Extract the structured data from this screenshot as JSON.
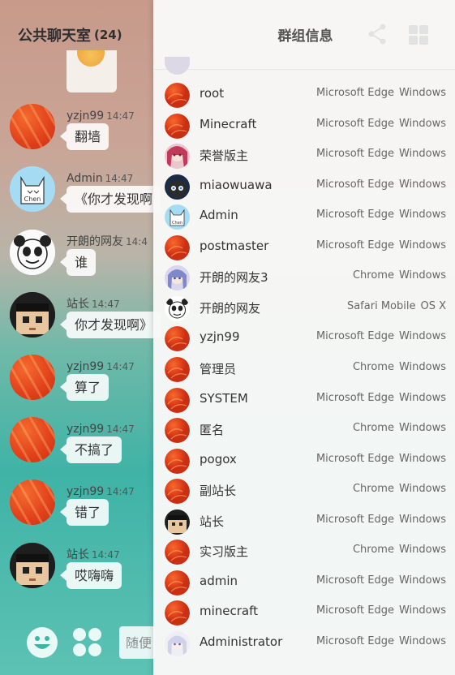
{
  "chat": {
    "title": "公共聊天室",
    "count": "(24)",
    "input_placeholder": "随便"
  },
  "messages": [
    {
      "nick": "yzjn99",
      "time": "14:47",
      "text": "翻墙",
      "avatar": "orange-avatar"
    },
    {
      "nick": "Admin",
      "time": "14:47",
      "text": "《你才发现啊",
      "avatar": "admin-avatar"
    },
    {
      "nick": "开朗的网友",
      "time": "14:4",
      "text": "谁",
      "avatar": "panda-avatar"
    },
    {
      "nick": "站长",
      "time": "14:47",
      "text": "你才发现啊》",
      "avatar": "pixel-avatar"
    },
    {
      "nick": "yzjn99",
      "time": "14:47",
      "text": "算了",
      "avatar": "orange-avatar"
    },
    {
      "nick": "yzjn99",
      "time": "14:47",
      "text": "不搞了",
      "avatar": "orange-avatar"
    },
    {
      "nick": "yzjn99",
      "time": "14:47",
      "text": "错了",
      "avatar": "orange-avatar"
    },
    {
      "nick": "站长",
      "time": "14:47",
      "text": "哎嗨嗨",
      "avatar": "pixel-avatar"
    }
  ],
  "group_info": {
    "title": "群组信息",
    "members": [
      {
        "name": "root",
        "browser": "Microsoft Edge",
        "os": "Windows",
        "avatar": "orange"
      },
      {
        "name": "Minecraft",
        "browser": "Microsoft Edge",
        "os": "Windows",
        "avatar": "orange"
      },
      {
        "name": "荣誉版主",
        "browser": "Microsoft Edge",
        "os": "Windows",
        "avatar": "anime-pink"
      },
      {
        "name": "miaowuawa",
        "browser": "Microsoft Edge",
        "os": "Windows",
        "avatar": "cat-dark"
      },
      {
        "name": "Admin",
        "browser": "Microsoft Edge",
        "os": "Windows",
        "avatar": "admin"
      },
      {
        "name": "postmaster",
        "browser": "Microsoft Edge",
        "os": "Windows",
        "avatar": "orange"
      },
      {
        "name": "开朗的网友3",
        "browser": "Chrome",
        "os": "Windows",
        "avatar": "anime-blue"
      },
      {
        "name": "开朗的网友",
        "browser": "Safari Mobile",
        "os": "OS X",
        "avatar": "panda"
      },
      {
        "name": "yzjn99",
        "browser": "Microsoft Edge",
        "os": "Windows",
        "avatar": "orange"
      },
      {
        "name": "管理员",
        "browser": "Chrome",
        "os": "Windows",
        "avatar": "orange"
      },
      {
        "name": "SYSTEM",
        "browser": "Microsoft Edge",
        "os": "Windows",
        "avatar": "orange"
      },
      {
        "name": "匿名",
        "browser": "Chrome",
        "os": "Windows",
        "avatar": "orange"
      },
      {
        "name": "pogox",
        "browser": "Microsoft Edge",
        "os": "Windows",
        "avatar": "orange"
      },
      {
        "name": "副站长",
        "browser": "Chrome",
        "os": "Windows",
        "avatar": "orange"
      },
      {
        "name": "站长",
        "browser": "Microsoft Edge",
        "os": "Windows",
        "avatar": "pixel"
      },
      {
        "name": "实习版主",
        "browser": "Chrome",
        "os": "Windows",
        "avatar": "orange"
      },
      {
        "name": "admin",
        "browser": "Microsoft Edge",
        "os": "Windows",
        "avatar": "orange"
      },
      {
        "name": "minecraft",
        "browser": "Microsoft Edge",
        "os": "Windows",
        "avatar": "orange"
      },
      {
        "name": "Administrator",
        "browser": "Microsoft Edge",
        "os": "Windows",
        "avatar": "anime-white"
      }
    ]
  },
  "colors": {
    "accent": "#3fb3a6",
    "avatar_orange": "#e2431c",
    "panel_bg": "#f8f8f7"
  }
}
